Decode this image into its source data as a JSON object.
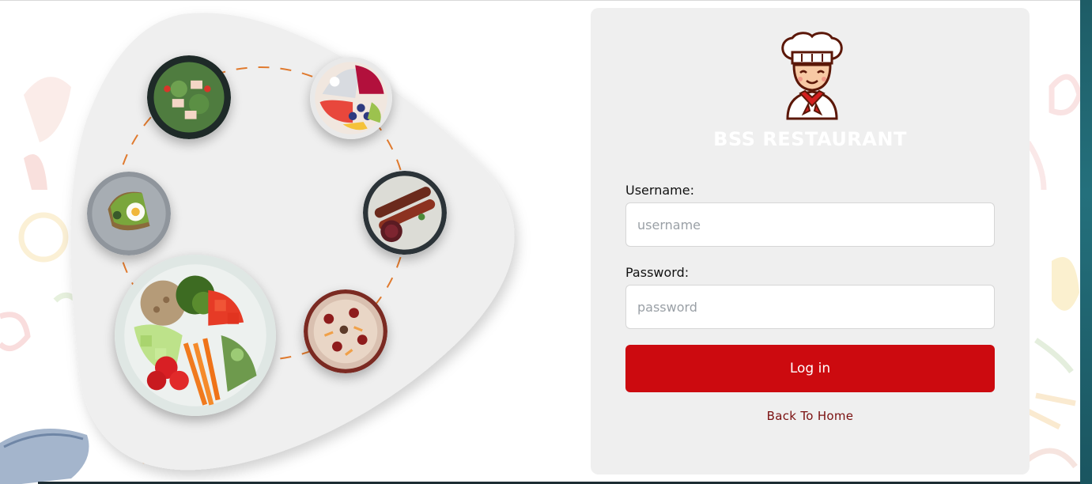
{
  "brand": {
    "name": "BSS RESTAURANT",
    "logo": "chef-mascot-icon"
  },
  "login_form": {
    "username_label": "Username:",
    "username_placeholder": "username",
    "username_value": "",
    "password_label": "Password:",
    "password_placeholder": "password",
    "password_value": "",
    "submit_label": "Log in",
    "back_link_label": "Back To Home"
  },
  "hero": {
    "dishes": [
      "salad",
      "fruit-bowl",
      "avocado-toast",
      "meat-skewers",
      "veggie-bowl",
      "pizza"
    ]
  },
  "colors": {
    "accent_red": "#cc0a0f",
    "link_red": "#7a1010",
    "dash_orange": "#e07a2e",
    "card_bg": "#efefef"
  }
}
